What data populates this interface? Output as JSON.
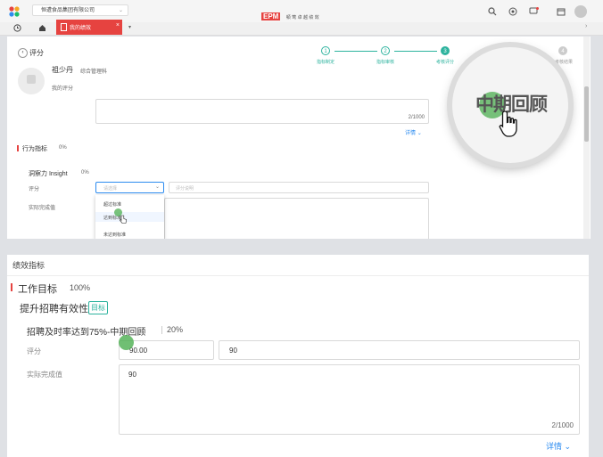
{
  "app": {
    "company_name": "恒遭食品集团有限公司",
    "brand": "EPM",
    "brand_sub": "頓 莺 卓 越 绩 效",
    "tab_label": "我的绩效"
  },
  "header": {
    "back_label": "评分",
    "user_name": "祖少丹",
    "user_dept": "综合管理科",
    "my_rating": "我的评分"
  },
  "steps": [
    {
      "num": "1",
      "label": "指标制定"
    },
    {
      "num": "2",
      "label": "指标审核"
    },
    {
      "num": "3",
      "label": "考核评分"
    },
    {
      "num": "4",
      "label": "考核结果"
    }
  ],
  "upper": {
    "counter": "2/1000",
    "details": "详情",
    "section_title": "行为指标",
    "section_pct": "0%",
    "item_title": "洞察力 Insight",
    "item_pct": "0%",
    "score_label": "评分",
    "select_placeholder": "请选择",
    "input_placeholder": "评分说明",
    "actual_label": "实际完成值",
    "dropdown": [
      "超过标准",
      "达到标准",
      "未达到标准"
    ]
  },
  "magnifier_text": "中期回顾",
  "lower": {
    "panel_title": "绩效指标",
    "section_title": "工作目标",
    "section_pct": "100%",
    "goal_title": "提升招聘有效性",
    "goal_tag": "目标",
    "item_title": "招聘及时率达到75%-中期回顾",
    "item_pct": "20%",
    "score_label": "评分",
    "score_value": "90.00",
    "score_comment": "90",
    "actual_label": "实际完成值",
    "actual_value": "90",
    "counter": "2/1000",
    "details": "详情"
  }
}
